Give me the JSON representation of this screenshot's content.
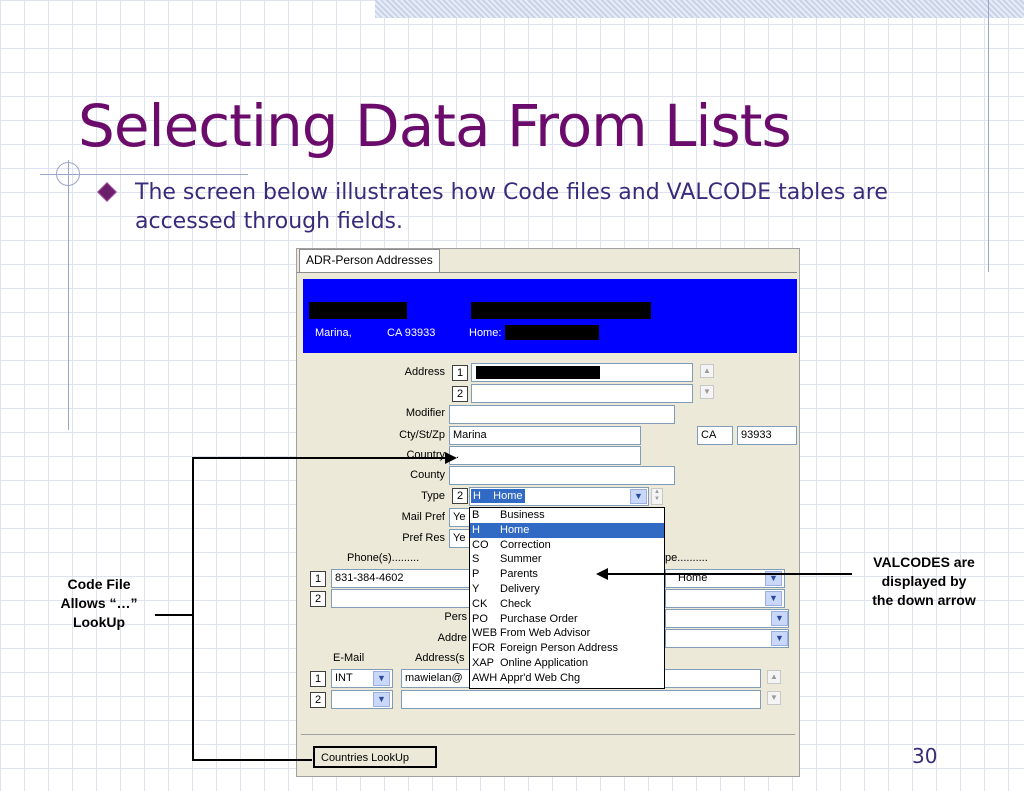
{
  "slide": {
    "title": "Selecting Data From Lists",
    "bullet": "The screen below illustrates how Code files and VALCODE tables are accessed through fields.",
    "page_number": "30"
  },
  "window": {
    "tab_label": "ADR-Person Addresses",
    "header": {
      "city": "Marina,",
      "state_zip": "CA  93933",
      "home_label": "Home:"
    },
    "labels": {
      "address": "Address",
      "modifier": "Modifier",
      "cty_st_zp": "Cty/St/Zp",
      "country": "Country",
      "county": "County",
      "type": "Type",
      "mail_pref": "Mail Pref",
      "pref_res": "Pref Res",
      "phones": "Phone(s).........",
      "phone_type": "pe..........",
      "person": "Pers",
      "address_short": "Addre",
      "email": "E-Mail",
      "addresses": "Address(s"
    },
    "numbers": {
      "one": "1",
      "two": "2"
    },
    "values": {
      "city": "Marina",
      "state": "CA",
      "zip": "93933",
      "country": "..",
      "type": "H    Home",
      "mail_pref": "Ye",
      "pref_res": "Ye",
      "phone1": "831-384-4602",
      "phone_type1": "Home",
      "email_type1": "INT",
      "email1": "mawielan@"
    },
    "type_options": [
      {
        "code": "B",
        "label": "Business",
        "selected": false
      },
      {
        "code": "H",
        "label": "Home",
        "selected": true
      },
      {
        "code": "CO",
        "label": "Correction",
        "selected": false
      },
      {
        "code": "S",
        "label": "Summer",
        "selected": false
      },
      {
        "code": "P",
        "label": "Parents",
        "selected": false
      },
      {
        "code": "Y",
        "label": "Delivery",
        "selected": false
      },
      {
        "code": "CK",
        "label": "Check",
        "selected": false
      },
      {
        "code": "PO",
        "label": "Purchase Order",
        "selected": false
      },
      {
        "code": "WEB",
        "label": "From Web Advisor",
        "selected": false
      },
      {
        "code": "FOR",
        "label": "Foreign Person Address",
        "selected": false
      },
      {
        "code": "XAP",
        "label": "Online Application",
        "selected": false
      },
      {
        "code": "AWH",
        "label": "Appr'd Web Chg",
        "selected": false
      }
    ],
    "bottom_button": "Countries LookUp"
  },
  "annotations": {
    "left": [
      "Code File",
      "Allows “…”",
      "LookUp"
    ],
    "right": [
      "VALCODES are",
      "displayed by",
      "the down arrow"
    ]
  },
  "icons": {
    "dropdown": "chevron-down-icon",
    "scroll_up": "scroll-up-icon",
    "scroll_down": "scroll-down-icon",
    "diamond": "diamond-bullet-icon"
  }
}
